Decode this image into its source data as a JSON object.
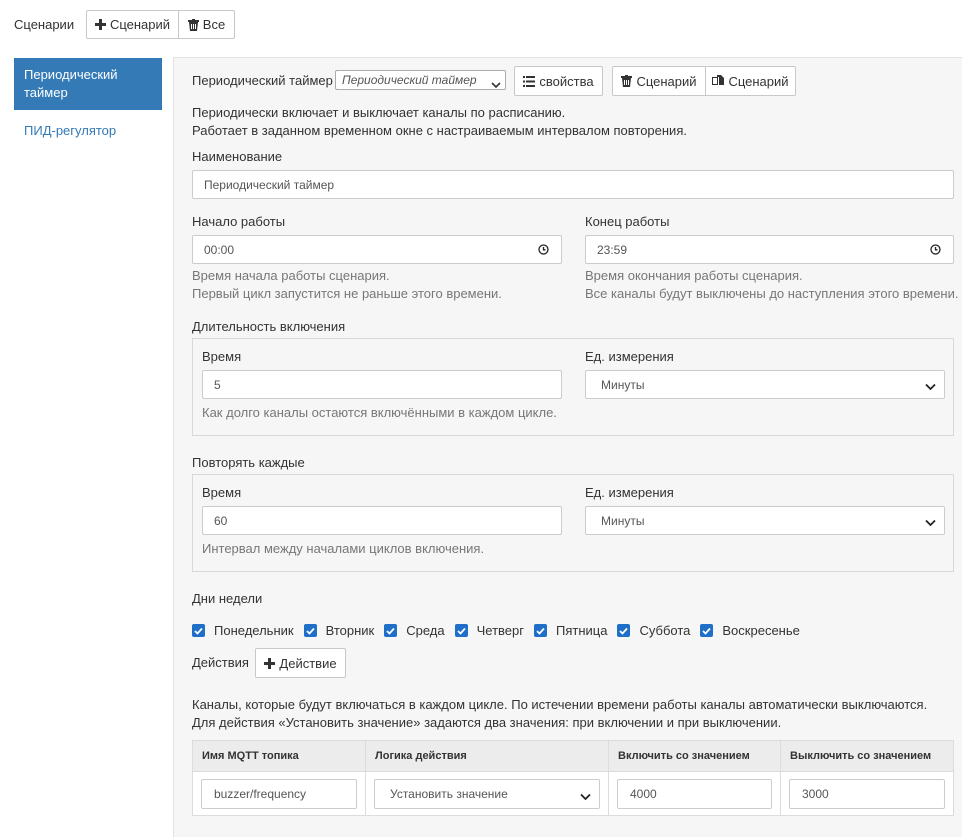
{
  "header": {
    "title": "Сценарии",
    "add_scenario_label": "Сценарий",
    "delete_all_label": "Все"
  },
  "sidebar": {
    "items": [
      {
        "label": "Периодический таймер",
        "active": true
      },
      {
        "label": "ПИД-регулятор",
        "active": false
      }
    ]
  },
  "editor": {
    "type_label": "Периодический таймер",
    "type_select_value": "Периодический таймер",
    "properties_label": "свойства",
    "delete_scenario_label": "Сценарий",
    "copy_scenario_label": "Сценарий",
    "description_line1": "Периодически включает и выключает каналы по расписанию.",
    "description_line2": "Работает в заданном временном окне с настраиваемым интервалом повторения.",
    "name_label": "Наименование",
    "name_value": "Периодический таймер",
    "start_label": "Начало работы",
    "start_value": "00:00",
    "start_help1": "Время начала работы сценария.",
    "start_help2": "Первый цикл запустится не раньше этого времени.",
    "end_label": "Конец работы",
    "end_value": "23:59",
    "end_help1": "Время окончания работы сценария.",
    "end_help2": "Все каналы будут выключены до наступления этого времени.",
    "duration": {
      "legend": "Длительность включения",
      "time_label": "Время",
      "time_value": "5",
      "unit_label": "Ед. измерения",
      "unit_value": "Минуты",
      "help": "Как долго каналы остаются включёнными в каждом цикле."
    },
    "repeat": {
      "legend": "Повторять каждые",
      "time_label": "Время",
      "time_value": "60",
      "unit_label": "Ед. измерения",
      "unit_value": "Минуты",
      "help": "Интервал между началами циклов включения."
    },
    "days_label": "Дни недели",
    "days": [
      {
        "label": "Понедельник",
        "checked": true
      },
      {
        "label": "Вторник",
        "checked": true
      },
      {
        "label": "Среда",
        "checked": true
      },
      {
        "label": "Четверг",
        "checked": true
      },
      {
        "label": "Пятница",
        "checked": true
      },
      {
        "label": "Суббота",
        "checked": true
      },
      {
        "label": "Воскресенье",
        "checked": true
      }
    ],
    "actions_label": "Действия",
    "add_action_label": "Действие",
    "actions_help1": "Каналы, которые будут включаться в каждом цикле. По истечении времени работы каналы автоматически выключаются.",
    "actions_help2": "Для действия «Установить значение» задаются два значения: при включении и при выключении.",
    "table": {
      "headers": [
        "Имя MQTT топика",
        "Логика действия",
        "Включить со значением",
        "Выключить со значением"
      ],
      "rows": [
        {
          "topic": "buzzer/frequency",
          "logic": "Установить значение",
          "on_value": "4000",
          "off_value": "3000"
        }
      ]
    }
  },
  "colors": {
    "accent": "#337ab7",
    "checkbox": "#1f6fc8",
    "panel_bg": "#f6f6f6"
  }
}
